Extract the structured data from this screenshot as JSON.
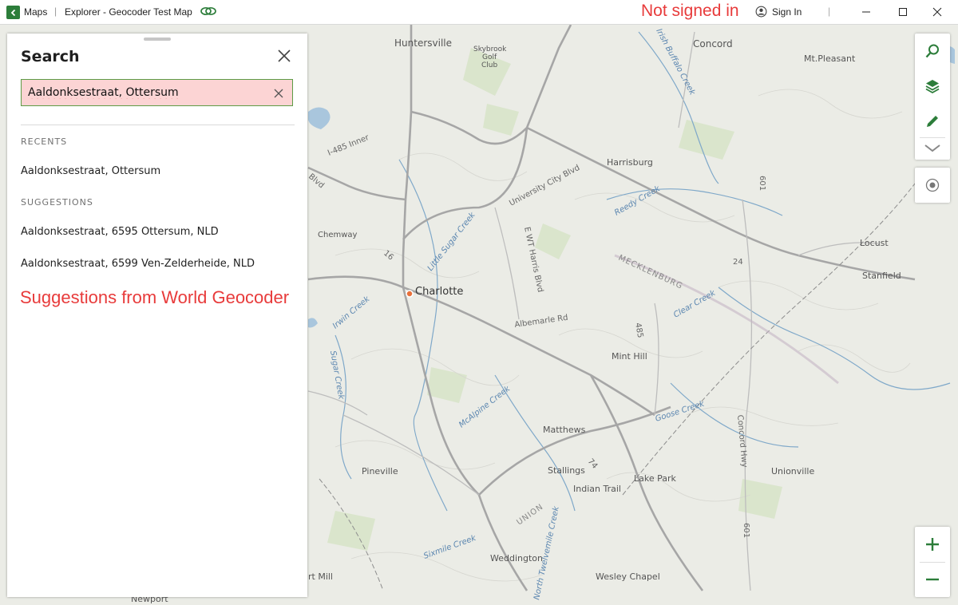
{
  "titlebar": {
    "app_name": "Maps",
    "separator": "|",
    "title": "Explorer - Geocoder Test Map",
    "sign_status_note": "Not signed in",
    "sign_in_label": "Sign In",
    "divider": "|"
  },
  "search_panel": {
    "title": "Search",
    "query": "Aaldonksestraat, Ottersum",
    "recents_label": "RECENTS",
    "recents": [
      "Aaldonksestraat, Ottersum"
    ],
    "suggestions_label": "SUGGESTIONS",
    "suggestions": [
      "Aaldonksestraat, 6595 Ottersum, NLD",
      "Aaldonksestraat, 6599 Ven-Zelderheide, NLD"
    ],
    "annotation": "Suggestions from World Geocoder"
  },
  "map": {
    "places": {
      "charlotte": "Charlotte",
      "huntersville": "Huntersville",
      "concord": "Concord",
      "mt_pleasant": "Mt.Pleasant",
      "harrisburg": "Harrisburg",
      "chemway": "Chemway",
      "locust": "Locust",
      "stanfield": "Stanfield",
      "mint_hill": "Mint Hill",
      "matthews": "Matthews",
      "stallings": "Stallings",
      "indian_trail": "Indian Trail",
      "lake_park": "Lake Park",
      "unionville": "Unionville",
      "pineville": "Pineville",
      "weddington": "Weddington",
      "wesley_chapel": "Wesley Chapel",
      "mecklenburg": "MECKLENBURG",
      "union": "UNION",
      "skybrook": "Skybrook",
      "golf": "Golf",
      "club": "Club",
      "newport": "Newport",
      "fort_mill": "rt Mill"
    },
    "roads": {
      "i485": "I-485 Inner",
      "blvd": "Blvd",
      "university_city": "University City Blvd",
      "albemarle": "Albemarle Rd",
      "wt_harris": "E WT Harris Blvd",
      "concord_hwy": "Concord Hwy",
      "r24": "24",
      "r74": "74",
      "r485": "485",
      "r16": "16",
      "r601": "601",
      "r601b": "601"
    },
    "waterways": {
      "irish_buffalo": "Irish Buffalo Creek",
      "reedy": "Reedy Creek",
      "little_sugar": "Little Sugar Creek",
      "irwin": "Irwin Creek",
      "sugar": "Sugar Creek",
      "mcalpine": "McAlpine Creek",
      "clear": "Clear Creek",
      "goose": "Goose Creek",
      "sixmile": "Sixmile Creek",
      "twelvemile": "North Twelvemile Creek"
    }
  },
  "icons": {
    "back": "chevron-left-icon",
    "link": "link-icon",
    "user": "user-circle-icon",
    "search": "search-icon",
    "layers": "layers-icon",
    "sketch": "pencil-icon",
    "expand": "chevron-down-icon",
    "locate": "location-target-icon",
    "zoom_in": "plus-icon",
    "zoom_out": "minus-icon"
  },
  "colors": {
    "accent": "#2c7d3a",
    "annotation": "#e83b3b",
    "search_field_bg": "#fcd4d4",
    "map_bg": "#ebece6",
    "road": "#9b9b9b",
    "water": "#7fa8c9"
  }
}
